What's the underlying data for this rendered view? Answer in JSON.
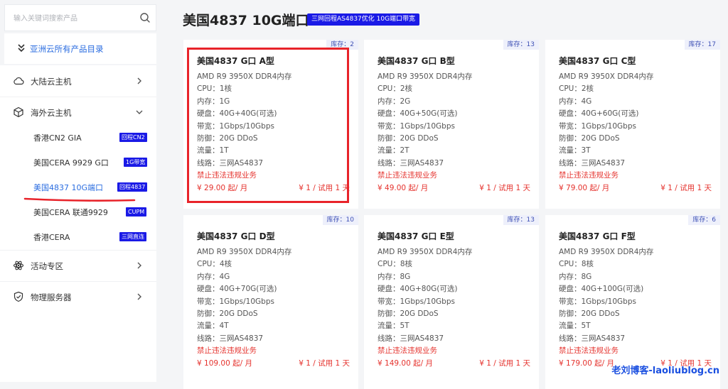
{
  "search": {
    "placeholder": "输入关键词搜索产品"
  },
  "catalog": {
    "label": "亚洲云所有产品目录"
  },
  "menu": {
    "mainland": "大陆云主机",
    "overseas": "海外云主机",
    "activities": "活动专区",
    "physical": "物理服务器",
    "sub_items": [
      {
        "label": "香港CN2 GIA",
        "badge": "回程CN2"
      },
      {
        "label": "美国CERA 9929 G口",
        "badge": "1G带宽"
      },
      {
        "label": "美国4837 10G端口",
        "badge": "回程4837"
      },
      {
        "label": "美国CERA 联通9929",
        "badge": "CUPM"
      },
      {
        "label": "香港CERA",
        "badge": "三网直连"
      }
    ]
  },
  "header": {
    "title": "美国4837 10G端口",
    "badge": "三网回程AS4837优化 10G端口带宽"
  },
  "cards": [
    {
      "stock": "库存：2",
      "title": "美国4837 G口 A型",
      "cpu_model": "AMD R9 3950X DDR4内存",
      "cpu": "CPU：1核",
      "ram": "内存：1G",
      "disk": "硬盘：40G+40G(可选)",
      "bandwidth": "带宽：1Gbps/10Gbps",
      "ddos": "防御：20G DDoS",
      "traffic": "流量：1T",
      "line": "线路：三网AS4837",
      "warning": "禁止违法违规业务",
      "price": "¥ 29.00 起/ 月",
      "trial": "¥ 1 / 试用 1 天"
    },
    {
      "stock": "库存：13",
      "title": "美国4837 G口 B型",
      "cpu_model": "AMD R9 3950X DDR4内存",
      "cpu": "CPU：2核",
      "ram": "内存：2G",
      "disk": "硬盘：40G+50G(可选)",
      "bandwidth": "带宽：1Gbps/10Gbps",
      "ddos": "防御：20G DDoS",
      "traffic": "流量：2T",
      "line": "线路：三网AS4837",
      "warning": "禁止违法违规业务",
      "price": "¥ 49.00 起/ 月",
      "trial": "¥ 1 / 试用 1 天"
    },
    {
      "stock": "库存：17",
      "title": "美国4837 G口 C型",
      "cpu_model": "AMD R9 3950X DDR4内存",
      "cpu": "CPU：2核",
      "ram": "内存：4G",
      "disk": "硬盘：40G+60G(可选)",
      "bandwidth": "带宽：1Gbps/10Gbps",
      "ddos": "防御：20G DDoS",
      "traffic": "流量：3T",
      "line": "线路：三网AS4837",
      "warning": "禁止违法违规业务",
      "price": "¥ 79.00 起/ 月",
      "trial": "¥ 1 / 试用 1 天"
    },
    {
      "stock": "库存：10",
      "title": "美国4837 G口 D型",
      "cpu_model": "AMD R9 3950X DDR4内存",
      "cpu": "CPU：4核",
      "ram": "内存：4G",
      "disk": "硬盘：40G+70G(可选)",
      "bandwidth": "带宽：1Gbps/10Gbps",
      "ddos": "防御：20G DDoS",
      "traffic": "流量：4T",
      "line": "线路：三网AS4837",
      "warning": "禁止违法违规业务",
      "price": "¥ 109.00 起/ 月",
      "trial": "¥ 1 / 试用 1 天"
    },
    {
      "stock": "库存：13",
      "title": "美国4837 G口 E型",
      "cpu_model": "AMD R9 3950X DDR4内存",
      "cpu": "CPU：8核",
      "ram": "内存：8G",
      "disk": "硬盘：40G+80G(可选)",
      "bandwidth": "带宽：1Gbps/10Gbps",
      "ddos": "防御：20G DDoS",
      "traffic": "流量：5T",
      "line": "线路：三网AS4837",
      "warning": "禁止违法违规业务",
      "price": "¥ 149.00 起/ 月",
      "trial": "¥ 1 / 试用 1 天"
    },
    {
      "stock": "库存：6",
      "title": "美国4837 G口 F型",
      "cpu_model": "AMD R9 3950X DDR4内存",
      "cpu": "CPU：8核",
      "ram": "内存：8G",
      "disk": "硬盘：40G+100G(可选)",
      "bandwidth": "带宽：1Gbps/10Gbps",
      "ddos": "防御：20G DDoS",
      "traffic": "流量：5T",
      "line": "线路：三网AS4837",
      "warning": "禁止违法违规业务",
      "price": "¥ 179.00 起/ 月",
      "trial": "¥ 1 / 试用 1 天"
    }
  ],
  "watermark": "老刘博客-laoliublog.cn",
  "colors": {
    "accent": "#2b6de0",
    "badge": "#1a1ae6",
    "price": "#e5322d",
    "highlight": "#e8232a"
  }
}
